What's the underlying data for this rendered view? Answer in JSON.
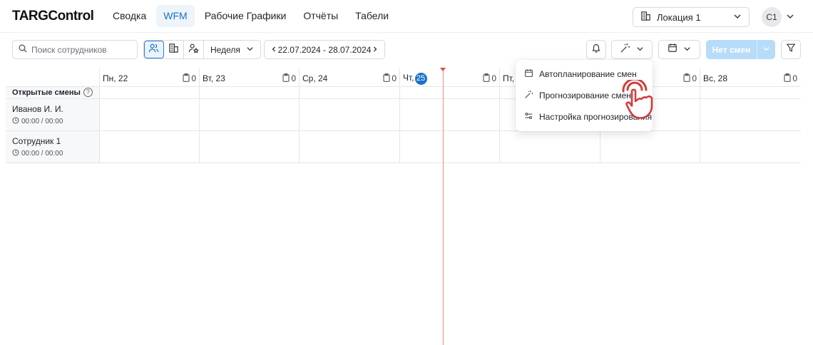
{
  "app": {
    "logo": "TARGControl"
  },
  "nav": {
    "items": [
      {
        "label": "Сводка",
        "active": false
      },
      {
        "label": "WFM",
        "active": true
      },
      {
        "label": "Рабочие Графики",
        "active": false
      },
      {
        "label": "Отчёты",
        "active": false
      },
      {
        "label": "Табели",
        "active": false
      }
    ]
  },
  "location": {
    "label": "Локация 1"
  },
  "user": {
    "initials": "С1"
  },
  "toolbar": {
    "search_placeholder": "Поиск сотрудников",
    "period": "Неделя",
    "date_range": "22.07.2024 - 28.07.2024",
    "no_shifts_label": "Нет смен",
    "accent": "#1b73c7",
    "disabled_button_color": "#b7dcfa"
  },
  "days": [
    {
      "label": "Пн, 22",
      "count": "0"
    },
    {
      "label": "Вт, 23",
      "count": "0"
    },
    {
      "label": "Ср, 24",
      "count": "0"
    },
    {
      "label": "Чт,",
      "badge": "25",
      "count": "0"
    },
    {
      "label": "Пт,",
      "count": "0"
    },
    {
      "label": "",
      "count": "0"
    },
    {
      "label": "Вс, 28",
      "count": "0"
    }
  ],
  "rows": {
    "open_shifts": "Открытые смены",
    "help": "?",
    "employees": [
      {
        "name": "Иванов И. И.",
        "time": "00:00 / 00:00"
      },
      {
        "name": "Сотрудник 1",
        "time": "00:00 / 00:00"
      }
    ]
  },
  "menu": {
    "items": [
      {
        "label": "Автопланирование смен",
        "icon": "calendar-icon"
      },
      {
        "label": "Прогнозирование смен",
        "icon": "magic-wand-icon"
      },
      {
        "label": "Настройка прогнозирования",
        "icon": "settings-sliders-icon"
      }
    ]
  },
  "now_line_color": "#f08a80"
}
